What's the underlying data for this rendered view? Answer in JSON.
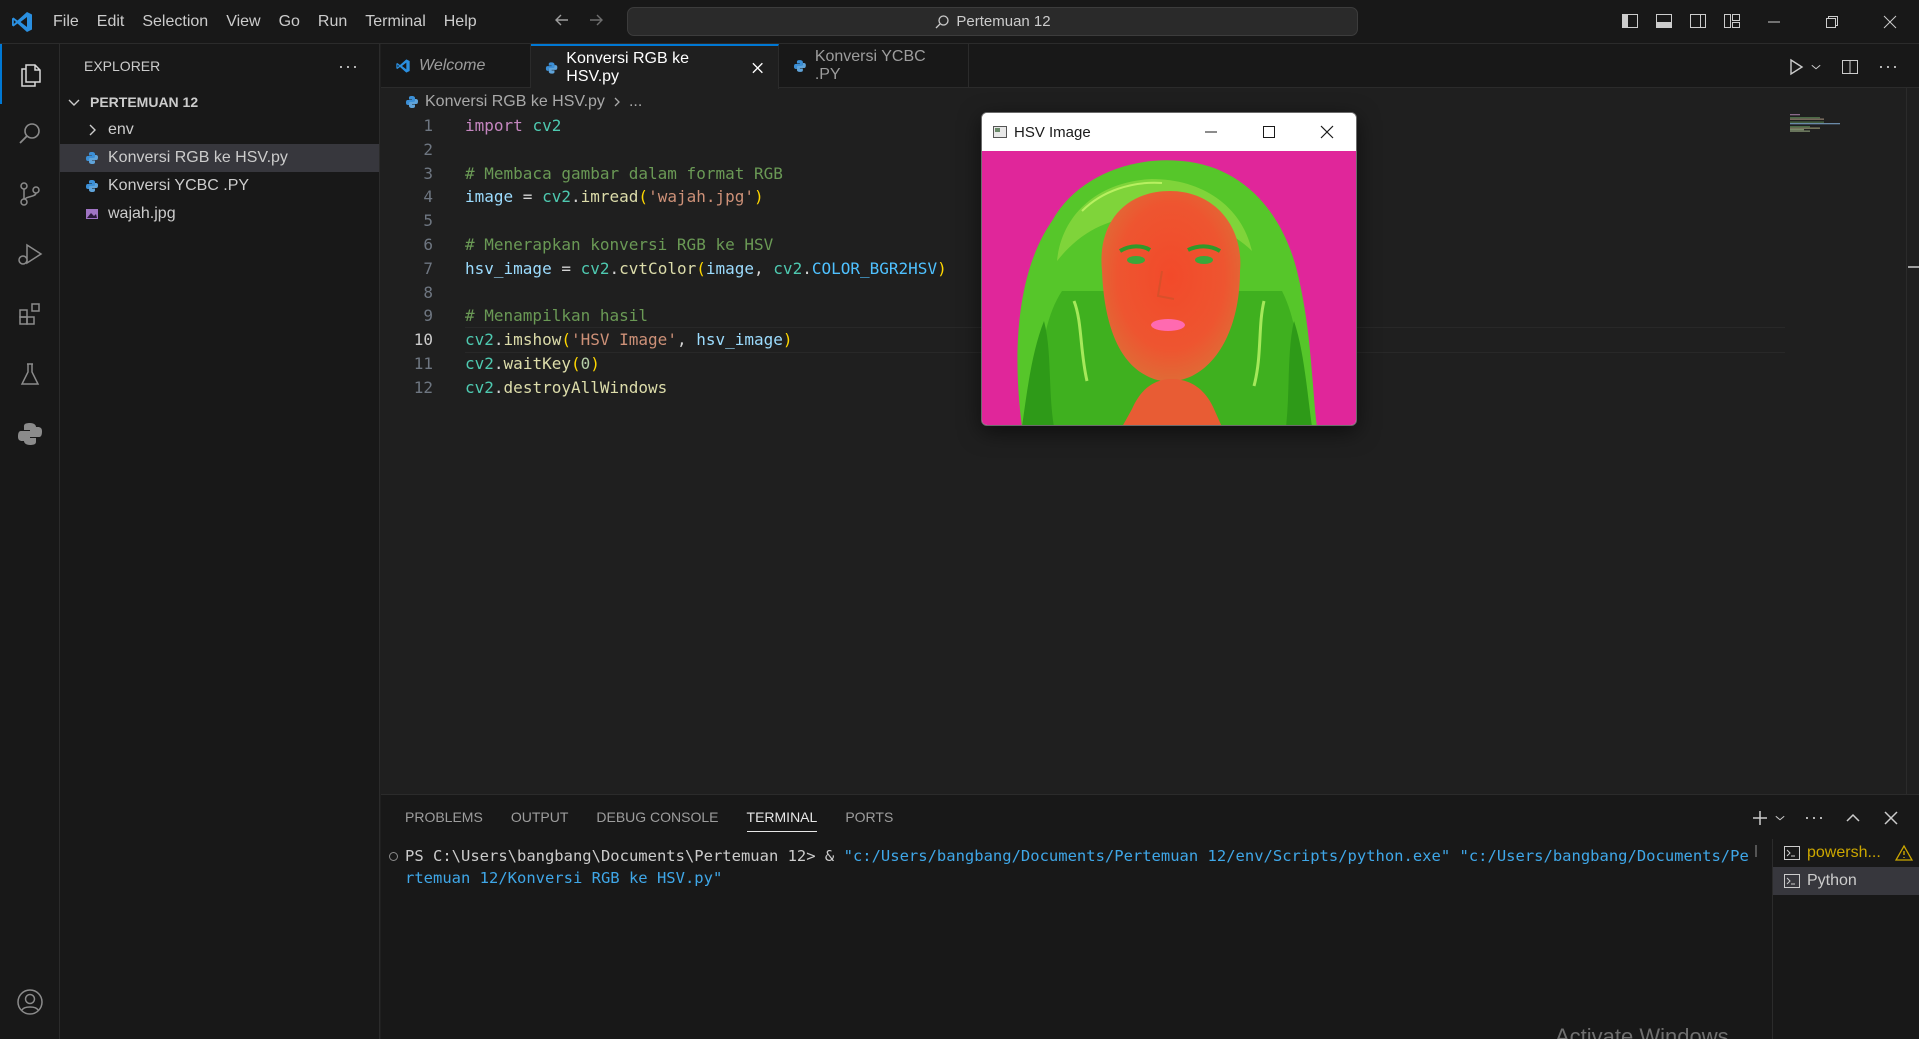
{
  "menubar": {
    "items": [
      "File",
      "Edit",
      "Selection",
      "View",
      "Go",
      "Run",
      "Terminal",
      "Help"
    ]
  },
  "command_center": {
    "text": "Pertemuan 12"
  },
  "explorer": {
    "title": "EXPLORER",
    "more": "···",
    "section": "PERTEMUAN 12",
    "items": [
      {
        "label": "env",
        "type": "folder"
      },
      {
        "label": "Konversi RGB ke HSV.py",
        "type": "python",
        "selected": true
      },
      {
        "label": "Konversi YCBC .PY",
        "type": "python"
      },
      {
        "label": "wajah.jpg",
        "type": "image"
      }
    ]
  },
  "tabs": [
    {
      "label": "Welcome",
      "active": false
    },
    {
      "label": "Konversi RGB ke HSV.py",
      "active": true
    },
    {
      "label": "Konversi YCBC .PY",
      "active": false
    }
  ],
  "breadcrumb": {
    "file": "Konversi RGB ke HSV.py",
    "rest": "..."
  },
  "code": {
    "current_line": 10,
    "line_numbers": [
      "1",
      "2",
      "3",
      "4",
      "5",
      "6",
      "7",
      "8",
      "9",
      "10",
      "11",
      "12"
    ],
    "l1": {
      "kw": "import",
      "mod": "cv2"
    },
    "l3": "# Membaca gambar dalam format RGB",
    "l4": {
      "var": "image",
      "eq": " = ",
      "mod": "cv2",
      "dot": ".",
      "fn": "imread",
      "open": "(",
      "str": "'wajah.jpg'",
      "close": ")"
    },
    "l6": "# Menerapkan konversi RGB ke HSV",
    "l7": {
      "var": "hsv_image",
      "eq": " = ",
      "mod": "cv2",
      "dot": ".",
      "fn": "cvtColor",
      "open": "(",
      "arg1": "image",
      "comma": ", ",
      "mod2": "cv2",
      "dot2": ".",
      "const": "COLOR_BGR2HSV",
      "close": ")"
    },
    "l9": "# Menampilkan hasil",
    "l10": {
      "mod": "cv2",
      "dot": ".",
      "fn": "imshow",
      "open": "(",
      "str": "'HSV Image'",
      "comma": ", ",
      "arg": "hsv_image",
      "close": ")"
    },
    "l11": {
      "mod": "cv2",
      "dot": ".",
      "fn": "waitKey",
      "open": "(",
      "num": "0",
      "close": ")"
    },
    "l12": {
      "mod": "cv2",
      "dot": ".",
      "fn": "destroyAllWindows"
    }
  },
  "hsv_window": {
    "title": "HSV Image"
  },
  "panel": {
    "tabs": [
      "PROBLEMS",
      "OUTPUT",
      "DEBUG CONSOLE",
      "TERMINAL",
      "PORTS"
    ],
    "active_tab": "TERMINAL",
    "prompt": "PS C:\\Users\\bangbang\\Documents\\Pertemuan 12> & ",
    "path1": "\"c:/Users/bangbang/Documents/Pertemuan 12/env/Scripts/python.exe\"",
    "path2": " \"c:/Users/bangbang/Documents/Pertemuan 12/Konversi RGB ke HSV.py\"",
    "terminals": [
      {
        "label": "powersh...",
        "warning": true
      },
      {
        "label": "Python",
        "active": true
      }
    ]
  },
  "watermark": "Activate Windows",
  "colors": {
    "accent": "#0078d4",
    "bg": "#1f1f1f",
    "sidebar": "#181818"
  }
}
